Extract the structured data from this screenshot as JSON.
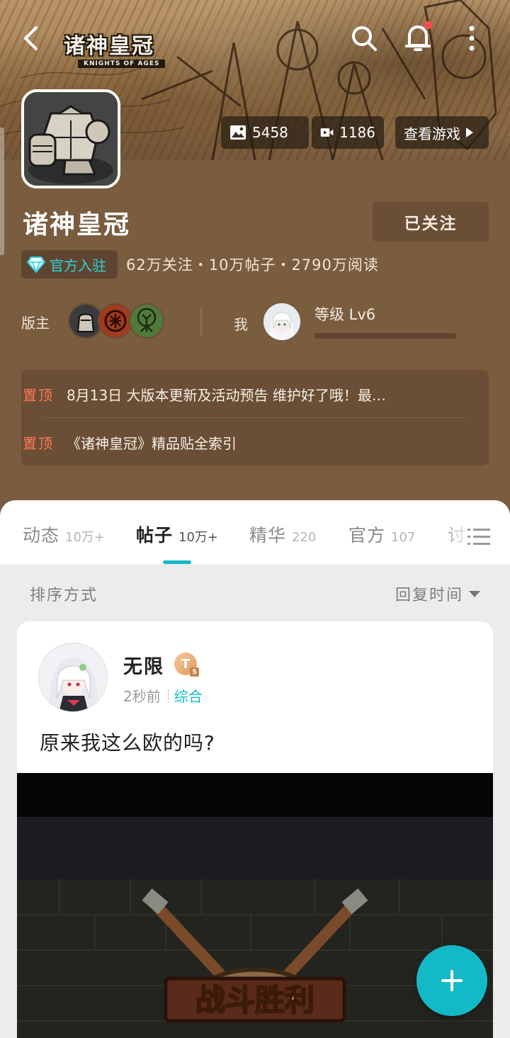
{
  "header": {
    "logo_text": "诸神皇冠",
    "logo_subtext": "KNIGHTS OF AGES",
    "stats_chips": {
      "images": "5458",
      "videos": "1186",
      "view_game": "查看游戏"
    },
    "game_title": "诸神皇冠",
    "follow_label": "已关注",
    "official_badge": "官方入驻",
    "stats_line": "62万关注・10万帖子・2790万阅读",
    "moderator_label": "版主",
    "me_label": "我",
    "level_text": "等级 Lv6",
    "pinned": [
      {
        "tag": "置顶",
        "text": "8月13日 大版本更新及活动预告 维护好了哦！最…"
      },
      {
        "tag": "置顶",
        "text": "《诸神皇冠》精品贴全索引"
      }
    ]
  },
  "tabs": [
    {
      "label": "动态",
      "count": "10万+"
    },
    {
      "label": "帖子",
      "count": "10万+"
    },
    {
      "label": "精华",
      "count": "220"
    },
    {
      "label": "官方",
      "count": "107"
    },
    {
      "label": "讨",
      "count": ""
    }
  ],
  "sort": {
    "label": "排序方式",
    "value": "回复时间"
  },
  "post": {
    "author": "无限",
    "badge": "T",
    "badge_level": "5",
    "time": "2秒前",
    "category": "综合",
    "text": "原来我这么欧的吗?",
    "image_caption": "战斗胜利"
  },
  "colors": {
    "accent": "#14b9c7",
    "header_bg": "#7a5c3f",
    "pinned_tag": "#ff7a55",
    "notification_dot": "#ff4b4b"
  },
  "icons": [
    "back-arrow-icon",
    "search-icon",
    "bell-icon",
    "more-vertical-icon",
    "image-icon",
    "video-icon",
    "play-triangle-icon",
    "diamond-icon",
    "list-menu-icon",
    "plus-icon"
  ]
}
